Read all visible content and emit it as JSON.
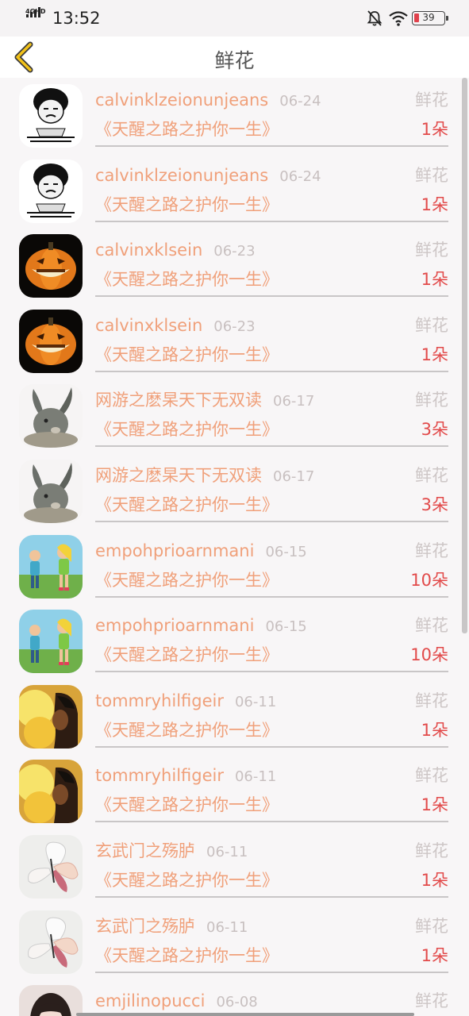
{
  "status_bar": {
    "network": "4GHD",
    "time": "13:52",
    "battery": "39"
  },
  "header": {
    "title": "鲜花"
  },
  "items": [
    {
      "user": "calvinklzeionunjeans",
      "date": "06-24",
      "type": "鲜花",
      "book": "《天醒之路之护你一生》",
      "count": "1朵",
      "avatar": "meme-face-avatar"
    },
    {
      "user": "calvinklzeionunjeans",
      "date": "06-24",
      "type": "鲜花",
      "book": "《天醒之路之护你一生》",
      "count": "1朵",
      "avatar": "meme-face-avatar"
    },
    {
      "user": "calvinxklsein",
      "date": "06-23",
      "type": "鲜花",
      "book": "《天醒之路之护你一生》",
      "count": "1朵",
      "avatar": "pumpkin-avatar"
    },
    {
      "user": "calvinxklsein",
      "date": "06-23",
      "type": "鲜花",
      "book": "《天醒之路之护你一生》",
      "count": "1朵",
      "avatar": "pumpkin-avatar"
    },
    {
      "user": "网游之麽杲天下无双读",
      "date": "06-17",
      "type": "鲜花",
      "book": "《天醒之路之护你一生》",
      "count": "3朵",
      "avatar": "rabbit-avatar"
    },
    {
      "user": "网游之麽杲天下无双读",
      "date": "06-17",
      "type": "鲜花",
      "book": "《天醒之路之护你一生》",
      "count": "3朵",
      "avatar": "rabbit-avatar"
    },
    {
      "user": "empohprioarnmani",
      "date": "06-15",
      "type": "鲜花",
      "book": "《天醒之路之护你一生》",
      "count": "10朵",
      "avatar": "cartoon-kids-avatar"
    },
    {
      "user": "empohprioarnmani",
      "date": "06-15",
      "type": "鲜花",
      "book": "《天醒之路之护你一生》",
      "count": "10朵",
      "avatar": "cartoon-kids-avatar"
    },
    {
      "user": "tommryhilfigeir",
      "date": "06-11",
      "type": "鲜花",
      "book": "《天醒之路之护你一生》",
      "count": "1朵",
      "avatar": "fire-face-avatar"
    },
    {
      "user": "tommryhilfigeir",
      "date": "06-11",
      "type": "鲜花",
      "book": "《天醒之路之护你一生》",
      "count": "1朵",
      "avatar": "fire-face-avatar"
    },
    {
      "user": "玄武门之殇胪",
      "date": "06-11",
      "type": "鲜花",
      "book": "《天醒之路之护你一生》",
      "count": "1朵",
      "avatar": "butterfly-avatar"
    },
    {
      "user": "玄武门之殇胪",
      "date": "06-11",
      "type": "鲜花",
      "book": "《天醒之路之护你一生》",
      "count": "1朵",
      "avatar": "butterfly-avatar"
    },
    {
      "user": "emjilinopucci",
      "date": "06-08",
      "type": "鲜花",
      "book": "",
      "count": "",
      "avatar": "girl-avatar"
    }
  ]
}
